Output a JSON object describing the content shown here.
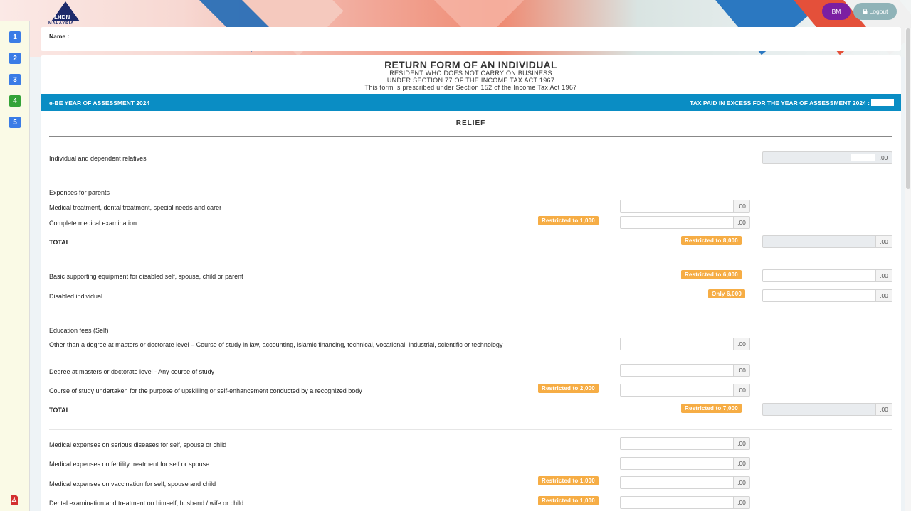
{
  "header": {
    "logo_text": "LHDN",
    "logo_subtext": "MALAYSIA",
    "lang_button": "BM",
    "logout_button": "Logout"
  },
  "sidebar": {
    "steps": [
      "1",
      "2",
      "3",
      "4",
      "5"
    ],
    "active_step": "4"
  },
  "name_card": {
    "label": "Name  :"
  },
  "form": {
    "title": "RETURN FORM OF AN INDIVIDUAL",
    "subtitle1": "RESIDENT WHO DOES NOT CARRY ON BUSINESS",
    "subtitle2": "UNDER SECTION 77 OF THE INCOME TAX ACT 1967",
    "subtitle3": "This form is prescribed under Section 152 of the Income Tax Act 1967",
    "bar_left": "e-BE YEAR OF ASSESSMENT 2024",
    "bar_right": "TAX PAID IN EXCESS FOR THE YEAR OF ASSESSMENT 2024 :",
    "section": "RELIEF"
  },
  "rows": {
    "individual": "Individual and dependent relatives",
    "parents_heading": "Expenses for parents",
    "parents_medical": "Medical treatment, dental treatment, special needs and carer",
    "parents_exam": "Complete medical examination",
    "parents_total": "TOTAL",
    "equipment": "Basic supporting equipment for disabled self, spouse, child or parent",
    "disabled": "Disabled individual",
    "edu_heading": "Education fees (Self)",
    "edu_other": "Other than a degree at masters or doctorate level – Course of study in law, accounting, islamic financing, technical, vocational, industrial, scientific or technology",
    "edu_masters": "Degree at masters or doctorate level - Any course of study",
    "edu_upskill": "Course of study undertaken for the purpose of upskilling or self-enhancement conducted by a recognized body",
    "edu_total": "TOTAL",
    "med_serious": "Medical expenses on serious diseases for self, spouse or child",
    "med_fertility": "Medical expenses on fertility treatment for self or spouse",
    "med_vaccination": "Medical expenses on vaccination for self, spouse and child",
    "med_dental": "Dental examination and treatment on himself, husband / wife or child"
  },
  "badges": {
    "r1000": "Restricted to 1,000",
    "r8000": "Restricted to 8,000",
    "r6000": "Restricted to 6,000",
    "only6000": "Only 6,000",
    "r2000": "Restricted to 2,000",
    "r7000": "Restricted to 7,000"
  },
  "cents_suffix": ".00"
}
